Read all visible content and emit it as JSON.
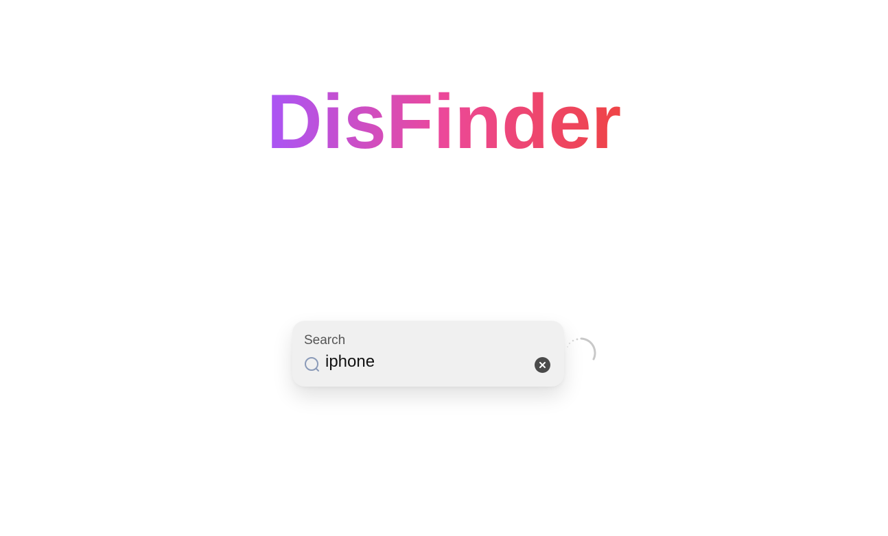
{
  "app": {
    "logo_text": "DisFinder"
  },
  "search": {
    "label": "Search",
    "value": "iphone",
    "placeholder": "",
    "clear_label": "clear"
  },
  "status": {
    "loading": true
  },
  "icons": {
    "search": "search-icon",
    "clear": "close-icon",
    "spinner": "loading-spinner-icon"
  },
  "colors": {
    "gradient_start": "#a855f7",
    "gradient_mid": "#ec4899",
    "gradient_end": "#ef4444",
    "search_bg": "#f0f0f0"
  }
}
